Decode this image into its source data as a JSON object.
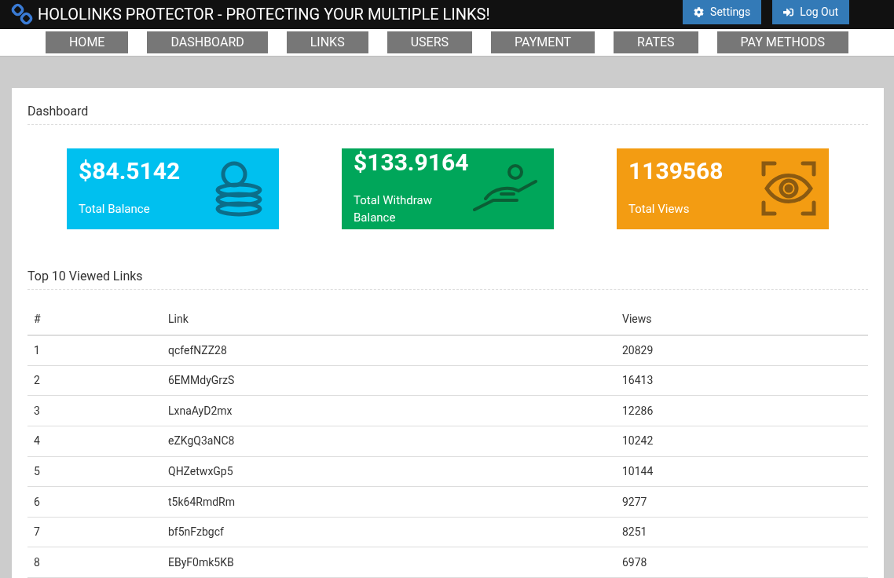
{
  "header": {
    "title": "HOLOLINKS PROTECTOR - PROTECTING YOUR MULTIPLE LINKS!",
    "buttons": [
      {
        "kind": "settings",
        "label": "Settings"
      },
      {
        "kind": "logout",
        "label": "Log Out"
      }
    ]
  },
  "nav": [
    {
      "label": "HOME"
    },
    {
      "label": "DASHBOARD"
    },
    {
      "label": "LINKS"
    },
    {
      "label": "USERS"
    },
    {
      "label": "PAYMENT"
    },
    {
      "label": "RATES"
    },
    {
      "label": "PAY METHODS"
    }
  ],
  "dashboard": {
    "title": "Dashboard",
    "cards": [
      {
        "kind": "coins",
        "value": "$84.5142",
        "label": "Total Balance",
        "color": "#00c0ef"
      },
      {
        "kind": "hand",
        "value": "$133.9164",
        "label": "Total Withdraw Balance",
        "color": "#00a65a"
      },
      {
        "kind": "eye",
        "value": "1139568",
        "label": "Total Views",
        "color": "#f39c12"
      }
    ]
  },
  "top_links": {
    "title": "Top 10 Viewed Links",
    "columns": [
      "#",
      "Link",
      "Views"
    ],
    "rows": [
      [
        "1",
        "qcfefNZZ28",
        "20829"
      ],
      [
        "2",
        "6EMMdyGrzS",
        "16413"
      ],
      [
        "3",
        "LxnaAyD2mx",
        "12286"
      ],
      [
        "4",
        "eZKgQ3aNC8",
        "10242"
      ],
      [
        "5",
        "QHZetwxGp5",
        "10144"
      ],
      [
        "6",
        "t5k64RmdRm",
        "9277"
      ],
      [
        "7",
        "bf5nFzbgcf",
        "8251"
      ],
      [
        "8",
        "EByF0mk5KB",
        "6978"
      ]
    ]
  }
}
